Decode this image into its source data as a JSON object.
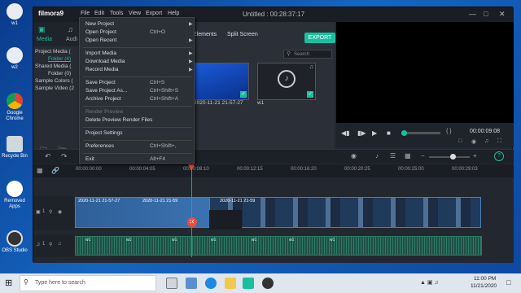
{
  "desktop": {
    "icons": [
      {
        "label": "w1"
      },
      {
        "label": "w2"
      },
      {
        "label": "Google Chrome"
      },
      {
        "label": "Recycle Bin"
      },
      {
        "label": "Removed Apps"
      },
      {
        "label": "OBS Studio"
      }
    ]
  },
  "app": {
    "logo": "filmora9",
    "title": "Untitled : 00:28:37:17",
    "menu": [
      "File",
      "Edit",
      "Tools",
      "View",
      "Export",
      "Help"
    ],
    "export_label": "EXPORT"
  },
  "left_panel": {
    "tabs": [
      "Media",
      "Audi"
    ],
    "tree": [
      "Project Media (",
      "Folder (4)",
      "Shared Media (",
      "Folder (0)",
      "Sample Colors (",
      "Sample Video (2"
    ]
  },
  "media": {
    "tabs": [
      "Elements",
      "Split Screen"
    ],
    "search_placeholder": "Search",
    "items": [
      {
        "caption": "2020-11-21 21-57-27"
      },
      {
        "caption": "w1"
      }
    ]
  },
  "preview": {
    "timecode": "00:00:09:08",
    "braces": "{ }"
  },
  "file_menu": {
    "items": [
      {
        "label": "New Project",
        "shortcut": "",
        "submenu": true,
        "disabled": false
      },
      {
        "label": "Open Project",
        "shortcut": "Ctrl+O",
        "submenu": false,
        "disabled": false
      },
      {
        "label": "Open Recent",
        "shortcut": "",
        "submenu": true,
        "disabled": false
      },
      {
        "label": "Import Media",
        "shortcut": "",
        "submenu": true,
        "disabled": false
      },
      {
        "label": "Download Media",
        "shortcut": "",
        "submenu": true,
        "disabled": false
      },
      {
        "label": "Record Media",
        "shortcut": "",
        "submenu": true,
        "disabled": false
      },
      {
        "label": "Save Project",
        "shortcut": "Ctrl+S",
        "submenu": false,
        "disabled": false
      },
      {
        "label": "Save Project As...",
        "shortcut": "Ctrl+Shift+S",
        "submenu": false,
        "disabled": false
      },
      {
        "label": "Archive Project",
        "shortcut": "Ctrl+Shift+A",
        "submenu": false,
        "disabled": false
      },
      {
        "label": "Render Preview",
        "shortcut": "",
        "submenu": false,
        "disabled": true
      },
      {
        "label": "Delete Preview Render Files",
        "shortcut": "",
        "submenu": false,
        "disabled": false
      },
      {
        "label": "Project Settings",
        "shortcut": "",
        "submenu": false,
        "disabled": false
      },
      {
        "label": "Preferences",
        "shortcut": "Ctrl+Shift+,",
        "submenu": false,
        "disabled": false
      },
      {
        "label": "Exit",
        "shortcut": "Alt+F4",
        "submenu": false,
        "disabled": false
      }
    ]
  },
  "timeline": {
    "ticks": [
      "00:00:00:00",
      "00:00:04:05",
      "00:00:08:10",
      "00:00:12:15",
      "00:00:16:20",
      "00:00:20:25",
      "00:00:25:00",
      "00:00:29:03"
    ],
    "video_clips": [
      "2020-11-21 21-57-27",
      "2020-11-21 21-59",
      "2020-11-21 21-59"
    ],
    "audio_labels": [
      "w1",
      "w1",
      "w1",
      "w1",
      "w1",
      "w1",
      "w1"
    ],
    "track_numbers": [
      "1",
      "1"
    ]
  },
  "taskbar": {
    "search_placeholder": "Type here to search",
    "time": "11:00 PM",
    "date": "11/21/2020"
  },
  "colors": {
    "accent": "#1bbfa0",
    "playhead": "#e94e3c",
    "clip": "#2f5f97",
    "audio": "#1f5045"
  }
}
